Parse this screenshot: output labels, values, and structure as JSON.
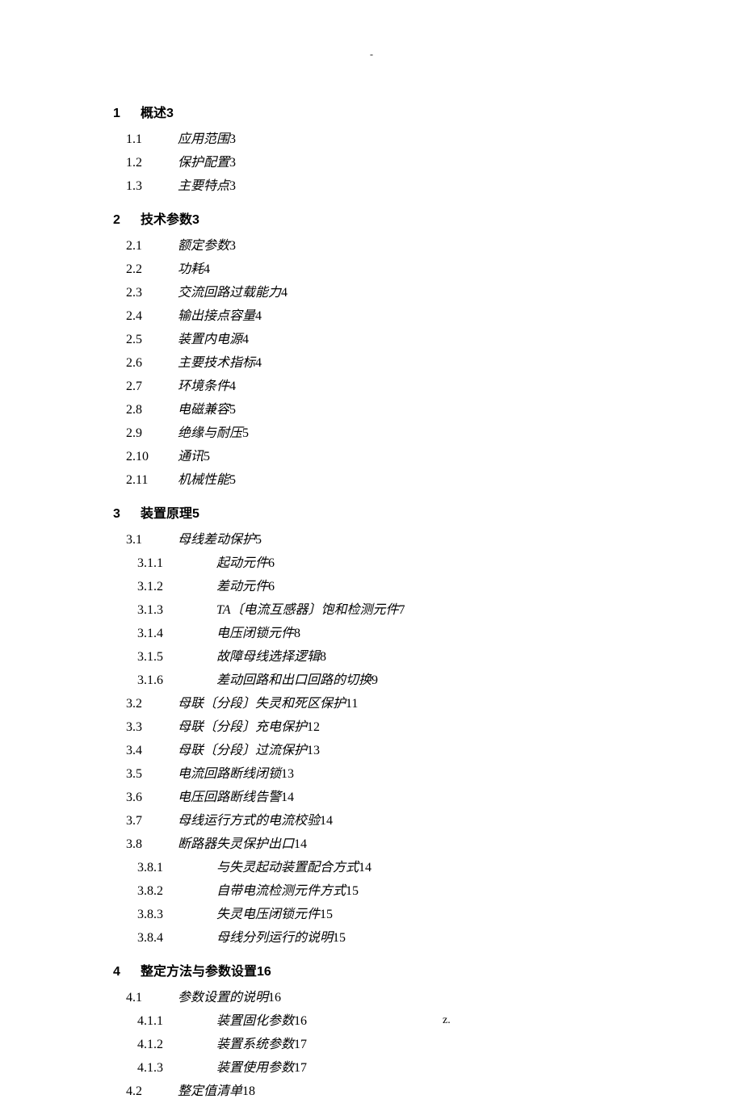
{
  "header_mark": "-",
  "footer_dot": ".",
  "footer_z": "z.",
  "toc": [
    {
      "level": 1,
      "num": "1",
      "title": "概述",
      "page": "3"
    },
    {
      "level": 2,
      "num": "1.1",
      "title": "应用范围",
      "page": "3"
    },
    {
      "level": 2,
      "num": "1.2",
      "title": "保护配置",
      "page": "3"
    },
    {
      "level": 2,
      "num": "1.3",
      "title": "主要特点",
      "page": "3"
    },
    {
      "level": 1,
      "num": "2",
      "title": "技术参数",
      "page": "3"
    },
    {
      "level": 2,
      "num": "2.1",
      "title": "额定参数",
      "page": "3"
    },
    {
      "level": 2,
      "num": "2.2",
      "title": "功耗",
      "page": "4"
    },
    {
      "level": 2,
      "num": "2.3",
      "title": "交流回路过载能力",
      "page": "4"
    },
    {
      "level": 2,
      "num": "2.4",
      "title": "输出接点容量",
      "page": "4"
    },
    {
      "level": 2,
      "num": "2.5",
      "title": "装置内电源",
      "page": "4"
    },
    {
      "level": 2,
      "num": "2.6",
      "title": "主要技术指标",
      "page": "4"
    },
    {
      "level": 2,
      "num": "2.7",
      "title": "环境条件",
      "page": "4"
    },
    {
      "level": 2,
      "num": "2.8",
      "title": "电磁兼容",
      "page": "5"
    },
    {
      "level": 2,
      "num": "2.9",
      "title": "绝缘与耐压",
      "page": "5"
    },
    {
      "level": 2,
      "num": "2.10",
      "title": "通讯",
      "page": "5"
    },
    {
      "level": 2,
      "num": "2.11",
      "title": "机械性能",
      "page": "5"
    },
    {
      "level": 1,
      "num": "3",
      "title": "装置原理",
      "page": "5"
    },
    {
      "level": 2,
      "num": "3.1",
      "title": "母线差动保护",
      "page": "5"
    },
    {
      "level": 3,
      "num": "3.1.1",
      "title": "起动元件",
      "page": "6"
    },
    {
      "level": 3,
      "num": "3.1.2",
      "title": "差动元件",
      "page": "6"
    },
    {
      "level": 3,
      "num": "3.1.3",
      "title": "TA〔电流互感器〕饱和检测元件",
      "page": "7"
    },
    {
      "level": 3,
      "num": "3.1.4",
      "title": "电压闭锁元件",
      "page": "8"
    },
    {
      "level": 3,
      "num": "3.1.5",
      "title": "故障母线选择逻辑",
      "page": "8"
    },
    {
      "level": 3,
      "num": "3.1.6",
      "title": "差动回路和出口回路的切换",
      "page": "9"
    },
    {
      "level": 2,
      "num": "3.2",
      "title": "母联〔分段〕失灵和死区保护",
      "page": "11"
    },
    {
      "level": 2,
      "num": "3.3",
      "title": "母联〔分段〕充电保护",
      "page": "12"
    },
    {
      "level": 2,
      "num": "3.4",
      "title": "母联〔分段〕过流保护",
      "page": "13"
    },
    {
      "level": 2,
      "num": "3.5",
      "title": "电流回路断线闭锁",
      "page": "13"
    },
    {
      "level": 2,
      "num": "3.6",
      "title": "电压回路断线告警",
      "page": "14"
    },
    {
      "level": 2,
      "num": "3.7",
      "title": "母线运行方式的电流校验",
      "page": "14"
    },
    {
      "level": 2,
      "num": "3.8",
      "title": "断路器失灵保护出口",
      "page": "14"
    },
    {
      "level": 3,
      "num": "3.8.1",
      "title": "与失灵起动装置配合方式",
      "page": "14"
    },
    {
      "level": 3,
      "num": "3.8.2",
      "title": "自带电流检测元件方式",
      "page": "15"
    },
    {
      "level": 3,
      "num": "3.8.3",
      "title": "失灵电压闭锁元件",
      "page": "15"
    },
    {
      "level": 3,
      "num": "3.8.4",
      "title": "母线分列运行的说明",
      "page": "15"
    },
    {
      "level": 1,
      "num": "4",
      "title": "整定方法与参数设置",
      "page": "16"
    },
    {
      "level": 2,
      "num": "4.1",
      "title": "参数设置的说明",
      "page": "16"
    },
    {
      "level": 3,
      "num": "4.1.1",
      "title": "装置固化参数",
      "page": "16"
    },
    {
      "level": 3,
      "num": "4.1.2",
      "title": "装置系统参数",
      "page": "17"
    },
    {
      "level": 3,
      "num": "4.1.3",
      "title": "装置使用参数",
      "page": "17"
    },
    {
      "level": 2,
      "num": "4.2",
      "title": "整定值清单",
      "page": "18"
    }
  ]
}
